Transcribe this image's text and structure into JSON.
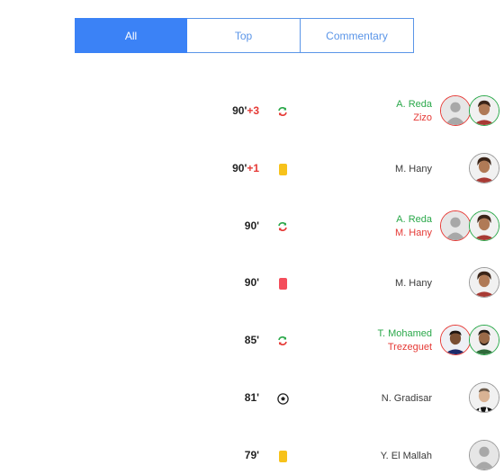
{
  "tabs": [
    {
      "label": "All",
      "active": true
    },
    {
      "label": "Top",
      "active": false
    },
    {
      "label": "Commentary",
      "active": false
    }
  ],
  "events": [
    {
      "minute": "90'",
      "extra": "+3",
      "type": "substitution",
      "in": "A. Reda",
      "out": "Zizo"
    },
    {
      "minute": "90'",
      "extra": "+1",
      "type": "yellow-card",
      "player": "M. Hany"
    },
    {
      "minute": "90'",
      "extra": "",
      "type": "substitution",
      "in": "A. Reda",
      "out": "M. Hany"
    },
    {
      "minute": "90'",
      "extra": "",
      "type": "red-card",
      "player": "M. Hany"
    },
    {
      "minute": "85'",
      "extra": "",
      "type": "substitution",
      "in": "T. Mohamed",
      "out": "Trezeguet"
    },
    {
      "minute": "81'",
      "extra": "",
      "type": "goal",
      "player": "N. Gradisar"
    },
    {
      "minute": "79'",
      "extra": "",
      "type": "yellow-card",
      "player": "Y. El Mallah"
    }
  ],
  "colors": {
    "accent": "#3b82f6",
    "sub_in": "#2aa84a",
    "sub_out": "#e53935",
    "yellow_card": "#f7c21b",
    "red_card": "#f44d5b"
  }
}
